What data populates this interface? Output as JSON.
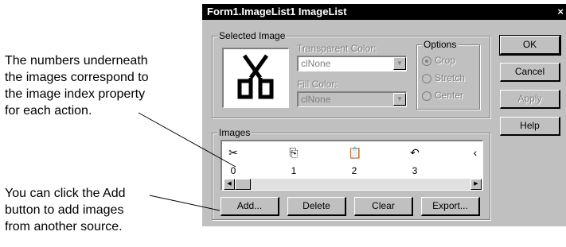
{
  "annotations": {
    "index_note": [
      "The numbers underneath",
      "the images correspond to",
      "the image index property",
      "for each action."
    ],
    "add_note": [
      "You can click the Add",
      "button to add images",
      "from another source."
    ]
  },
  "dialog": {
    "title": "Form1.ImageList1 ImageList",
    "close_glyph": "×",
    "selected_image": {
      "legend": "Selected Image",
      "transparent_color_label": "Transparent Color:",
      "transparent_color_value": "clNone",
      "fill_color_label": "Fill Color:",
      "fill_color_value": "clNone",
      "options": {
        "legend": "Options",
        "items": [
          "Crop",
          "Stretch",
          "Center"
        ],
        "selected": "Crop"
      }
    },
    "images": {
      "legend": "Images",
      "icons": [
        "cut-icon",
        "copy-icon",
        "paste-icon",
        "undo-icon"
      ],
      "indices": [
        "0",
        "1",
        "2",
        "3"
      ]
    },
    "buttons": {
      "ok": "OK",
      "cancel": "Cancel",
      "apply": "Apply",
      "help": "Help",
      "add": "Add...",
      "delete": "Delete",
      "clear": "Clear",
      "export": "Export..."
    }
  }
}
